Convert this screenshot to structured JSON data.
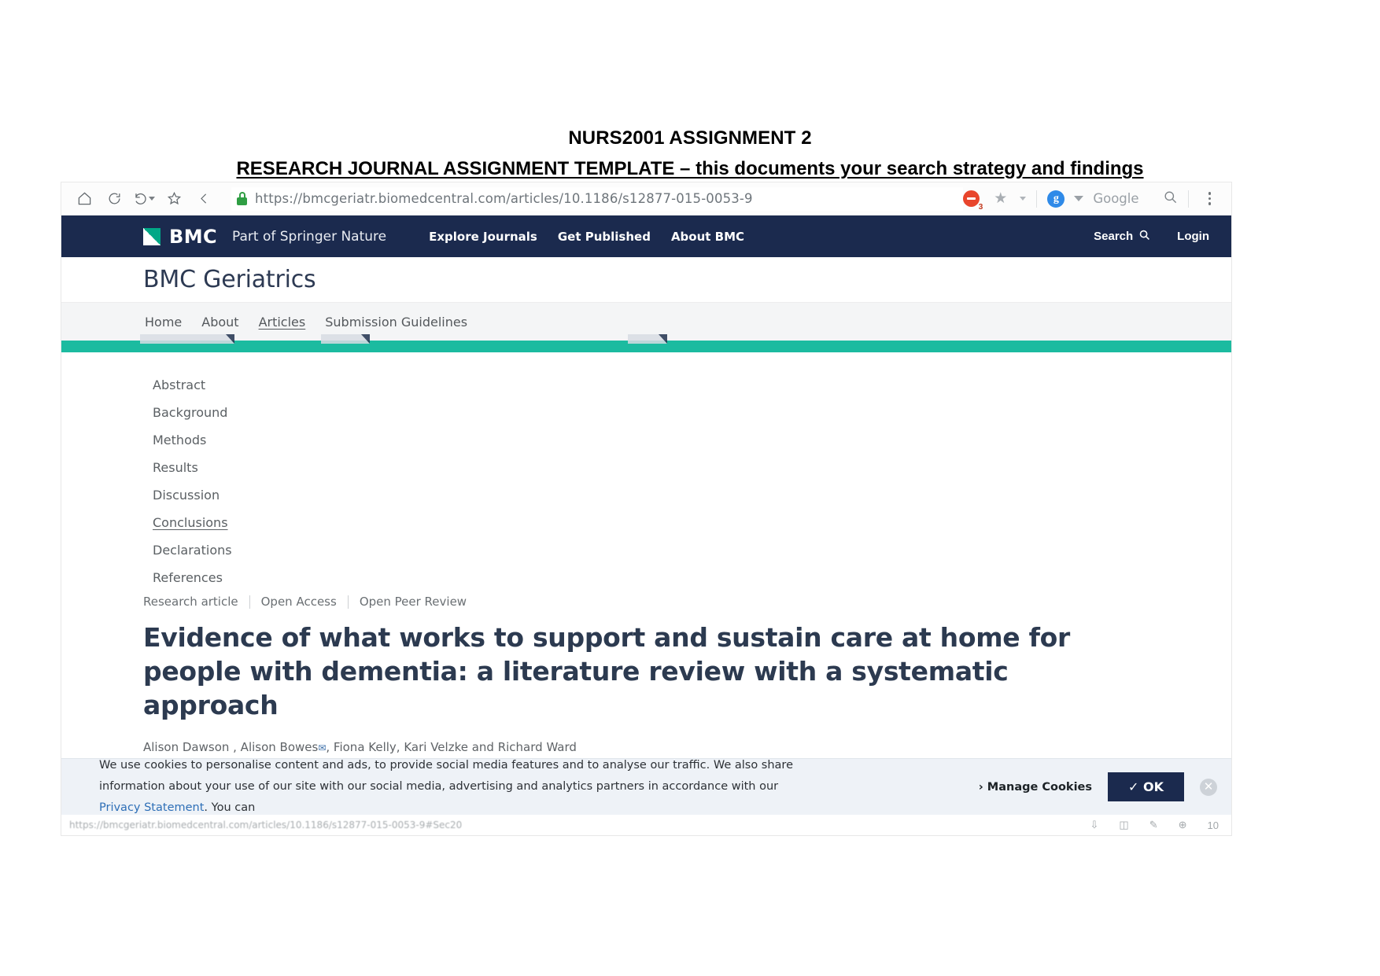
{
  "document": {
    "title_line1": "NURS2001 ASSIGNMENT 2",
    "title_line2": "RESEARCH JOURNAL ASSIGNMENT TEMPLATE – this documents your search strategy and findings"
  },
  "browser": {
    "toolbar": {
      "home_icon": "home-icon",
      "refresh_icon": "refresh-icon",
      "history_icon": "history-back-icon",
      "favorites_icon": "star-outline-icon",
      "back_icon": "chevron-left-icon",
      "lock_icon": "padlock-icon",
      "url": "https://bmcgeriatr.biomedcentral.com/articles/10.1186/s12877-015-0053-9",
      "adblock_icon": "adblock-icon",
      "adblock_badge": "3",
      "bookmark_star_icon": "star-filled-icon",
      "bookmark_caret_icon": "caret-down-icon",
      "account_icon": "google-account-icon",
      "account_initial": "g",
      "account_chevron_icon": "chevron-down-icon",
      "search_provider": "Google",
      "search_icon": "search-icon",
      "menu_icon": "kebab-menu-icon"
    },
    "statusbar": {
      "url": "https://bmcgeriatr.biomedcentral.com/articles/10.1186/s12877-015-0053-9#Sec20",
      "zoom": "10"
    }
  },
  "site": {
    "navbar": {
      "logo_mark": "bmc-logo-icon",
      "logo_text": "BMC",
      "logo_tagline": "Part of Springer Nature",
      "links": [
        {
          "label": "Explore Journals"
        },
        {
          "label": "Get Published"
        },
        {
          "label": "About BMC"
        }
      ],
      "search_label": "Search",
      "search_icon": "search-icon",
      "login_label": "Login"
    },
    "journal_name": "BMC Geriatrics",
    "subnav": [
      {
        "label": "Home",
        "active": false
      },
      {
        "label": "About",
        "active": false
      },
      {
        "label": "Articles",
        "active": true
      },
      {
        "label": "Submission Guidelines",
        "active": false
      }
    ]
  },
  "article": {
    "toc": [
      {
        "label": "Abstract",
        "underlined": false
      },
      {
        "label": "Background",
        "underlined": false
      },
      {
        "label": "Methods",
        "underlined": false
      },
      {
        "label": "Results",
        "underlined": false
      },
      {
        "label": "Discussion",
        "underlined": false
      },
      {
        "label": "Conclusions",
        "underlined": true
      },
      {
        "label": "Declarations",
        "underlined": false
      },
      {
        "label": "References",
        "underlined": false
      }
    ],
    "meta": {
      "type": "Research article",
      "access": "Open Access",
      "review": "Open Peer Review"
    },
    "title": "Evidence of what works to support and sustain care at home for people with dementia: a literature review with a systematic approach",
    "authors_pre": "Alison Dawson , Alison Bowes",
    "author_mail_icon": "envelope-icon",
    "authors_post": ", Fiona Kelly, Kari Velzke and Richard Ward"
  },
  "cookie_banner": {
    "text_part1": "We use cookies to personalise content and ads, to provide social media features and to analyse our traffic. We also share information about your use of our site with our social media, advertising and analytics partners in accordance with our ",
    "privacy_link": "Privacy Statement",
    "text_part2": ". You can",
    "manage_label": "Manage Cookies",
    "manage_chevron_icon": "chevron-right-icon",
    "ok_label": "✓ OK",
    "close_icon": "close-icon"
  },
  "colors": {
    "bmc_navy": "#1b2a4e",
    "bmc_teal": "#1cbba0",
    "bmc_green": "#00a887",
    "link_blue": "#2e6fb7"
  }
}
